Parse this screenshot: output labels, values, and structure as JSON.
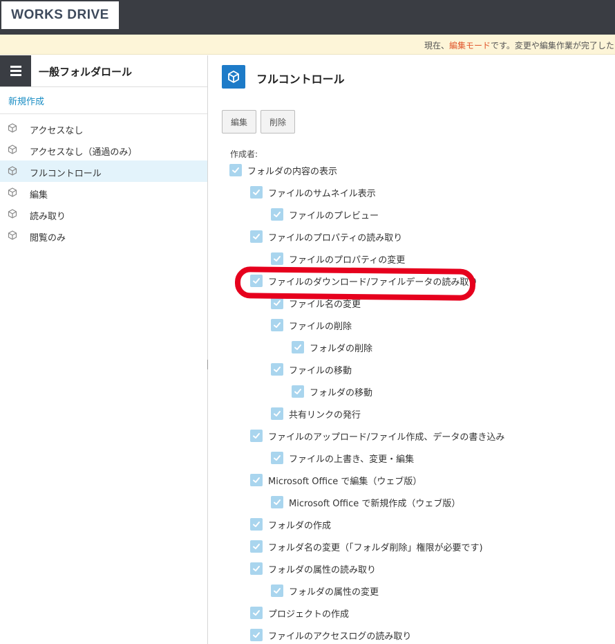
{
  "app": {
    "logo_text": "WORKS DRIVE"
  },
  "notice": {
    "prefix": "現在、",
    "mode": "編集モード",
    "suffix": "です。変更や編集作業が完了した"
  },
  "sidebar": {
    "title": "一般フォルダロール",
    "new_link": "新規作成",
    "items": [
      {
        "label": "アクセスなし",
        "icon": "cube-icon",
        "active": false
      },
      {
        "label": "アクセスなし（通過のみ）",
        "icon": "cube-icon",
        "active": false
      },
      {
        "label": "フルコントロール",
        "icon": "cube-icon",
        "active": true
      },
      {
        "label": "編集",
        "icon": "cube-icon",
        "active": false
      },
      {
        "label": "読み取り",
        "icon": "cube-icon",
        "active": false
      },
      {
        "label": "閲覧のみ",
        "icon": "cube-icon",
        "active": false
      }
    ]
  },
  "role": {
    "title": "フルコントロール",
    "edit_label": "編集",
    "delete_label": "削除",
    "creator_label": "作成者:",
    "permissions": [
      {
        "level": 0,
        "label": "フォルダの内容の表示",
        "checked": true
      },
      {
        "level": 1,
        "label": "ファイルのサムネイル表示",
        "checked": true
      },
      {
        "level": 2,
        "label": "ファイルのプレビュー",
        "checked": true
      },
      {
        "level": 1,
        "label": "ファイルのプロパティの読み取り",
        "checked": true
      },
      {
        "level": 2,
        "label": "ファイルのプロパティの変更",
        "checked": true
      },
      {
        "level": 1,
        "label": "ファイルのダウンロード/ファイルデータの読み取り",
        "checked": true
      },
      {
        "level": 2,
        "label": "ファイル名の変更",
        "checked": true
      },
      {
        "level": 2,
        "label": "ファイルの削除",
        "checked": true
      },
      {
        "level": 3,
        "label": "フォルダの削除",
        "checked": true
      },
      {
        "level": 2,
        "label": "ファイルの移動",
        "checked": true
      },
      {
        "level": 3,
        "label": "フォルダの移動",
        "checked": true
      },
      {
        "level": 2,
        "label": "共有リンクの発行",
        "checked": true
      },
      {
        "level": 1,
        "label": "ファイルのアップロード/ファイル作成、データの書き込み",
        "checked": true
      },
      {
        "level": 2,
        "label": "ファイルの上書き、変更・編集",
        "checked": true
      },
      {
        "level": 1,
        "label": "Microsoft Office で編集（ウェブ版）",
        "checked": true
      },
      {
        "level": 2,
        "label": "Microsoft Office で新規作成（ウェブ版）",
        "checked": true
      },
      {
        "level": 1,
        "label": "フォルダの作成",
        "checked": true
      },
      {
        "level": 1,
        "label": "フォルダ名の変更（「フォルダ削除」権限が必要です)",
        "checked": true
      },
      {
        "level": 1,
        "label": "フォルダの属性の読み取り",
        "checked": true
      },
      {
        "level": 2,
        "label": "フォルダの属性の変更",
        "checked": true
      },
      {
        "level": 1,
        "label": "プロジェクトの作成",
        "checked": true
      },
      {
        "level": 1,
        "label": "ファイルのアクセスログの読み取り",
        "checked": true
      }
    ]
  },
  "colors": {
    "accent_blue": "#1d7bc8",
    "topbar": "#3a3d43",
    "highlight": "#e6001d",
    "checkbox": "#a9d5ee"
  }
}
